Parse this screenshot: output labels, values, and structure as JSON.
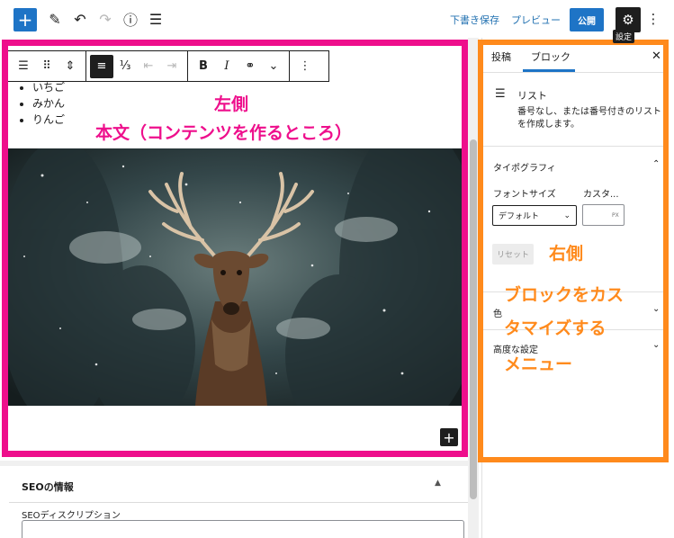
{
  "toolbar": {
    "add_label": "+",
    "save_draft": "下書き保存",
    "preview": "プレビュー",
    "publish": "公開",
    "settings_tooltip": "設定"
  },
  "editor": {
    "list_items": [
      "いちご",
      "みかん",
      "りんご"
    ],
    "image_alt": "deer-photo"
  },
  "annotations": {
    "left_title": "左側",
    "left_desc": "本文（コンテンツを作るところ）",
    "right_title": "右側",
    "right_desc_1": "ブロックをカス",
    "right_desc_2": "タマイズする",
    "right_desc_3": "メニュー",
    "left_color": "#ee0f8c",
    "right_color": "#ff8a1c"
  },
  "meta_box": {
    "title": "SEOの情報",
    "description_label": "SEOディスクリプション"
  },
  "sidebar": {
    "tabs": [
      "投稿",
      "ブロック"
    ],
    "block_name": "リスト",
    "block_desc": "番号なし、または番号付きのリストを作成します。",
    "typography_title": "タイポグラフィ",
    "font_size_label": "フォントサイズ",
    "custom_label": "カスタ...",
    "font_size_value": "デフォルト",
    "custom_unit": "PX",
    "reset_label": "リセット",
    "color_title": "色",
    "advanced_title": "高度な設定"
  },
  "colors": {
    "accent": "#1e74c6",
    "dark": "#1e1e1e"
  }
}
